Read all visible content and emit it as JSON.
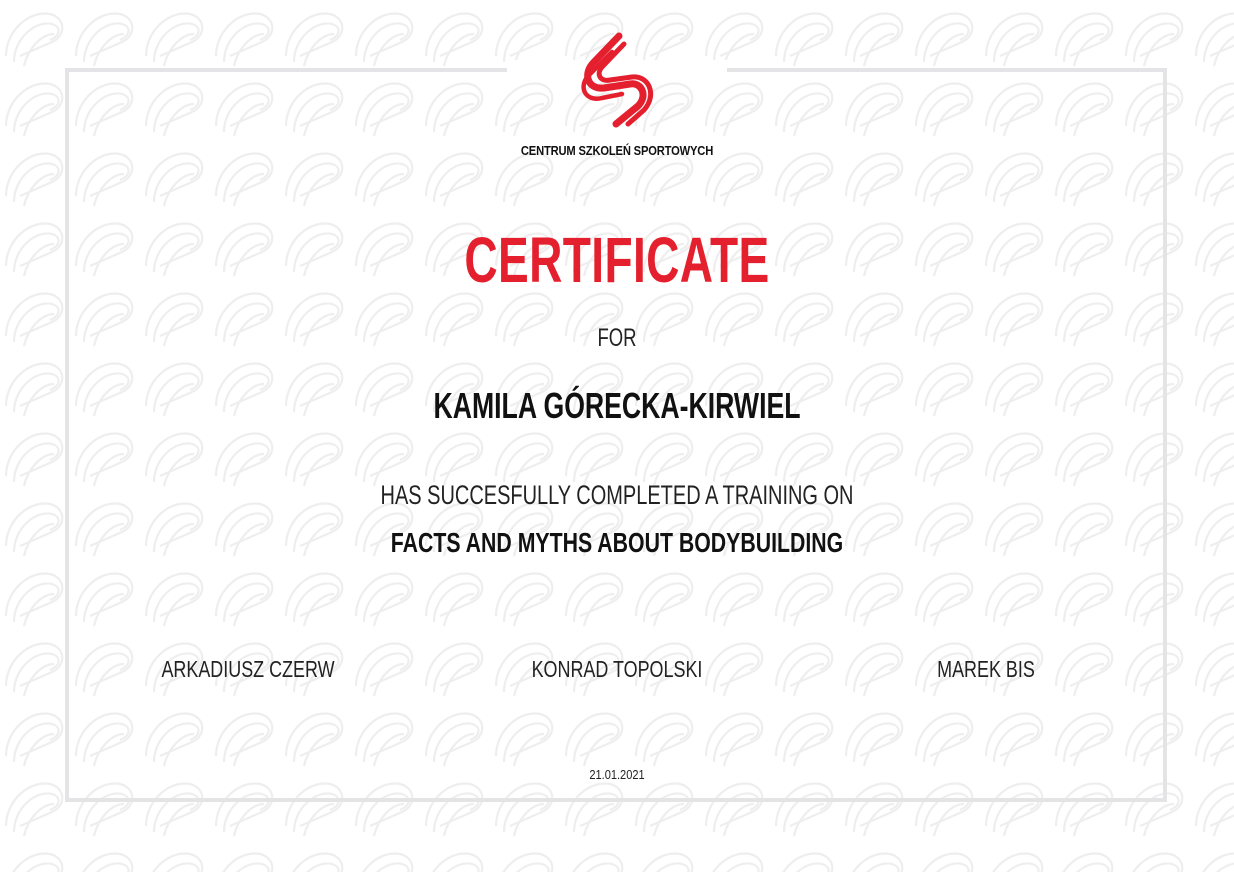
{
  "organization": {
    "name": "CENTRUM SZKOLEŃ SPORTOWYCH"
  },
  "certificate": {
    "title": "CERTIFICATE",
    "for_label": "FOR",
    "recipient": "KAMILA GÓRECKA-KIRWIEL",
    "completion_text": "HAS SUCCESFULLY COMPLETED A TRAINING ON",
    "course": "FACTS AND MYTHS ABOUT BODYBUILDING",
    "date": "21.01.2021"
  },
  "signers": [
    "ARKADIUSZ CZERW",
    "KONRAD TOPOLSKI",
    "MAREK BIS"
  ],
  "colors": {
    "accent": "#e5202e",
    "text": "#111111",
    "frame": "#e4e4e6",
    "pattern": "#efefef"
  },
  "icons": {
    "logo": "brand-logo-icon"
  }
}
